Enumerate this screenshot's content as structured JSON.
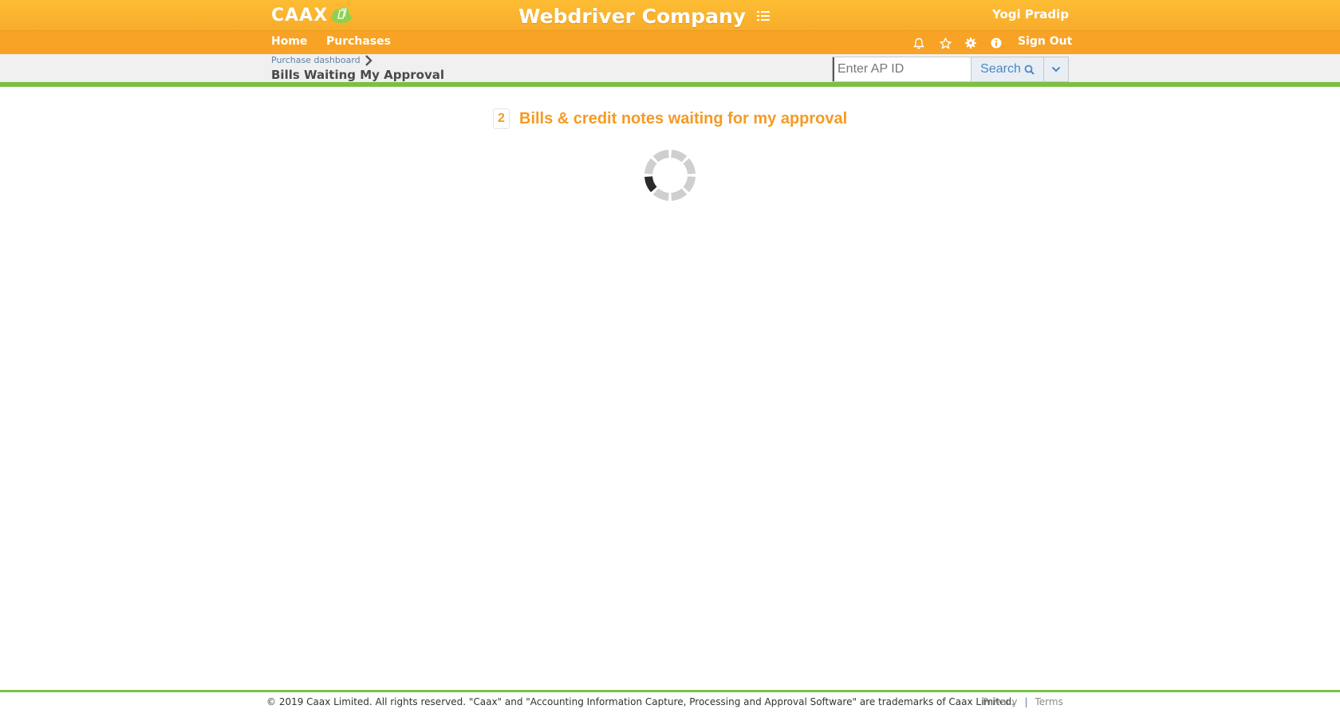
{
  "header": {
    "logo_text": "CAAX",
    "company_name": "Webdriver Company",
    "user_name": "Yogi Pradip"
  },
  "nav": {
    "home": "Home",
    "purchases": "Purchases",
    "sign_out": "Sign Out",
    "icons": [
      "bell-icon",
      "star-icon",
      "gear-icon",
      "info-icon"
    ]
  },
  "breadcrumb": {
    "parent": "Purchase dashboard",
    "current": "Bills Waiting My Approval"
  },
  "search": {
    "placeholder": "Enter AP ID",
    "value": "",
    "button_label": "Search"
  },
  "main": {
    "count": "2",
    "heading": "Bills & credit notes waiting for my approval"
  },
  "footer": {
    "copyright": "© 2019 Caax Limited. All rights reserved. \"Caax\" and \"Accounting Information Capture, Processing and Approval Software\" are trademarks of Caax Limited.",
    "privacy": "Privacy",
    "separator": "|",
    "terms": "Terms"
  },
  "colors": {
    "header_orange": "#fcbd33",
    "nav_orange": "#f8a326",
    "accent_green": "#7cc043",
    "heading_orange": "#f59a24",
    "link_blue": "#5e82a8"
  }
}
